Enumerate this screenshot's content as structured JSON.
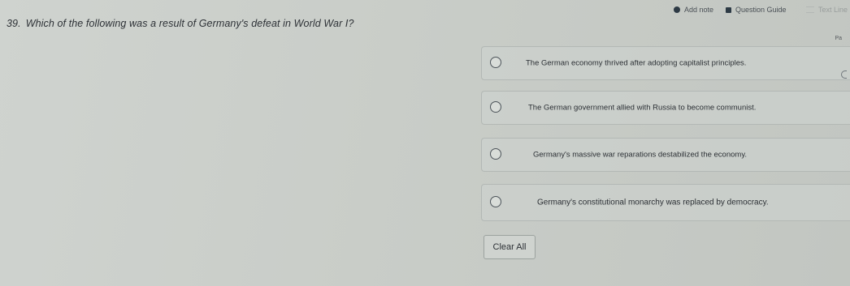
{
  "toolbar": {
    "add_note": "Add note",
    "question_guide": "Question Guide",
    "more": "Text Line"
  },
  "question": {
    "number": "39.",
    "text": "Which of the following was a result of Germany's defeat in World War I?"
  },
  "choices": [
    {
      "label": "The German economy thrived after adopting capitalist principles."
    },
    {
      "label": "The German government allied with Russia to become communist."
    },
    {
      "label": "Germany's massive war reparations destabilized the economy."
    },
    {
      "label": "Germany's constitutional monarchy was replaced by democracy."
    }
  ],
  "clear_button": "Clear All",
  "side": {
    "flag": "Pa"
  }
}
